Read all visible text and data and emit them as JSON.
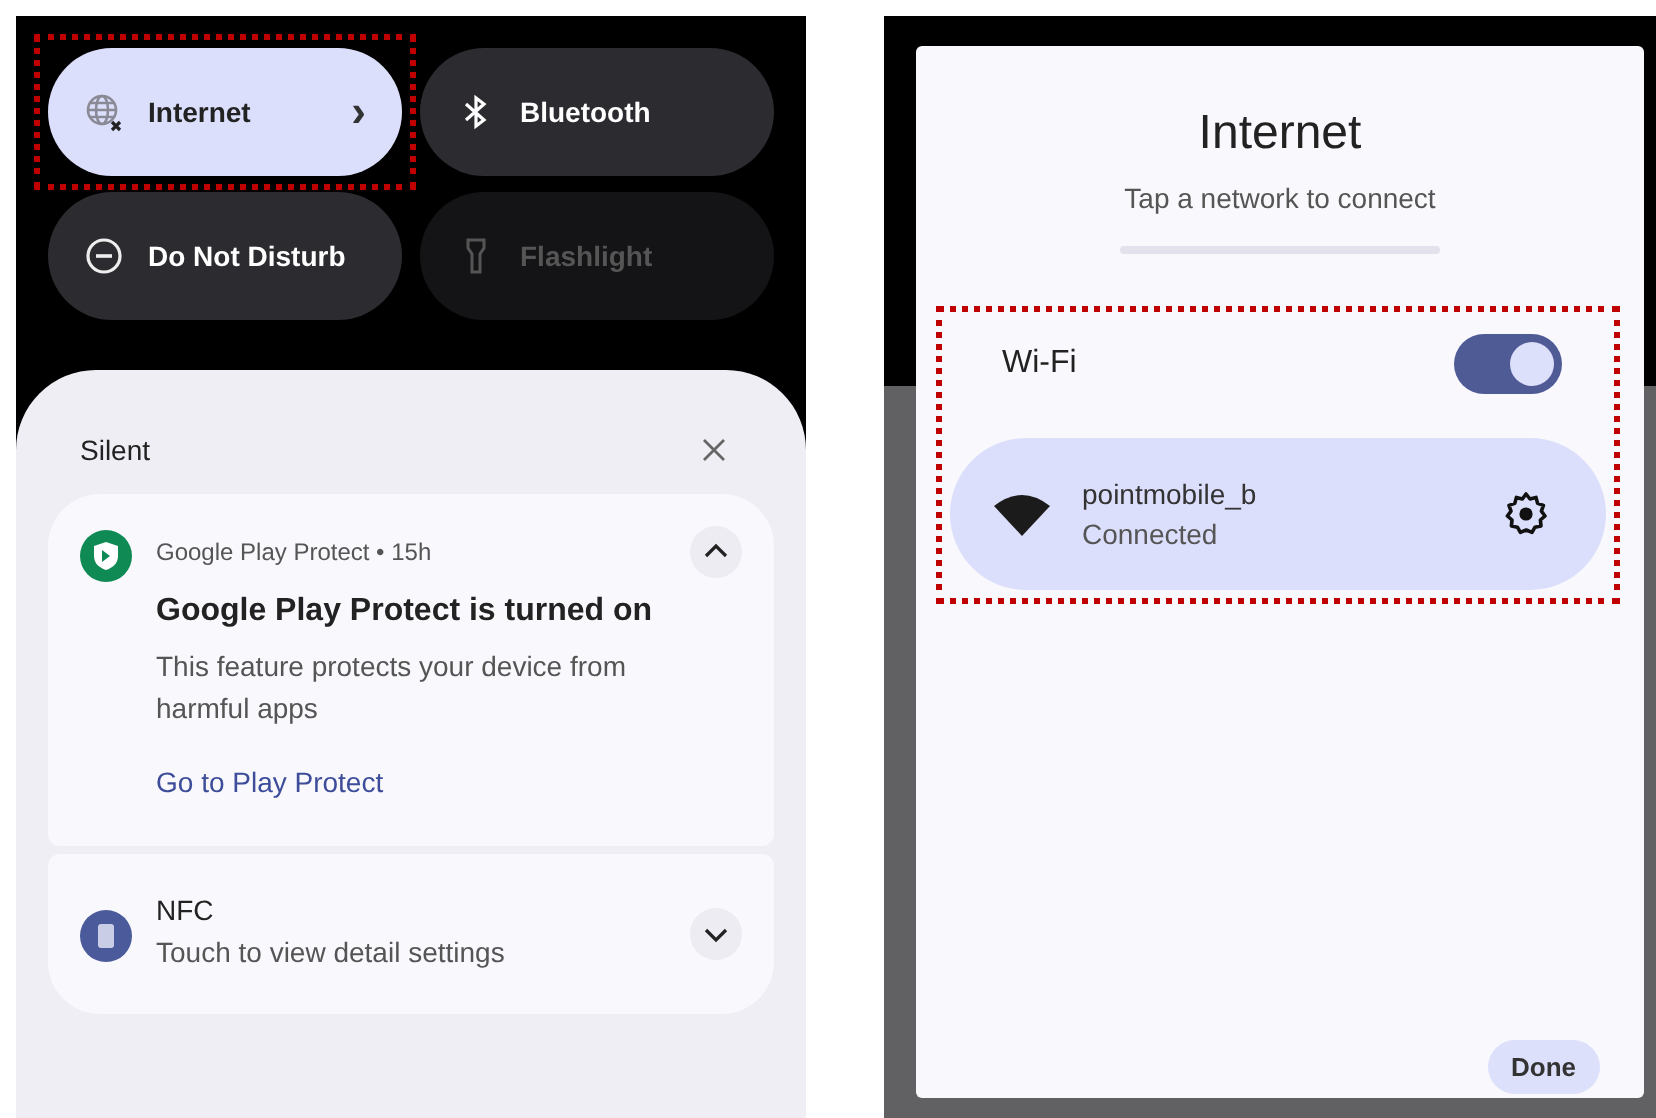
{
  "quick_settings": {
    "tiles": [
      {
        "label": "Internet",
        "kind": "globe",
        "on": true,
        "disabled": false,
        "chevron": "›",
        "highlighted": true
      },
      {
        "label": "Bluetooth",
        "kind": "bluetooth",
        "on": false,
        "disabled": false,
        "highlighted": false
      },
      {
        "label": "Do Not Disturb",
        "kind": "dnd",
        "on": false,
        "disabled": false,
        "highlighted": false
      },
      {
        "label": "Flashlight",
        "kind": "flashlight",
        "on": false,
        "disabled": true,
        "highlighted": false
      }
    ]
  },
  "notifications": {
    "section": "Silent",
    "items": [
      {
        "kind": "shield",
        "app": "Google Play Protect",
        "separator": "•",
        "time": "15h",
        "title": "Google Play Protect is turned on",
        "body": "This feature protects your device from harmful apps",
        "action": "Go to Play Protect",
        "expanded": true
      },
      {
        "kind": "nfc",
        "title": "NFC",
        "body": "Touch to view detail settings",
        "expanded": false
      }
    ]
  },
  "internet_dialog": {
    "title": "Internet",
    "subtitle": "Tap a network to connect",
    "highlighted": true,
    "wifi": {
      "label": "Wi-Fi",
      "on": true
    },
    "networks": [
      {
        "name": "pointmobile_b",
        "status": "Connected"
      }
    ],
    "done": "Done"
  }
}
